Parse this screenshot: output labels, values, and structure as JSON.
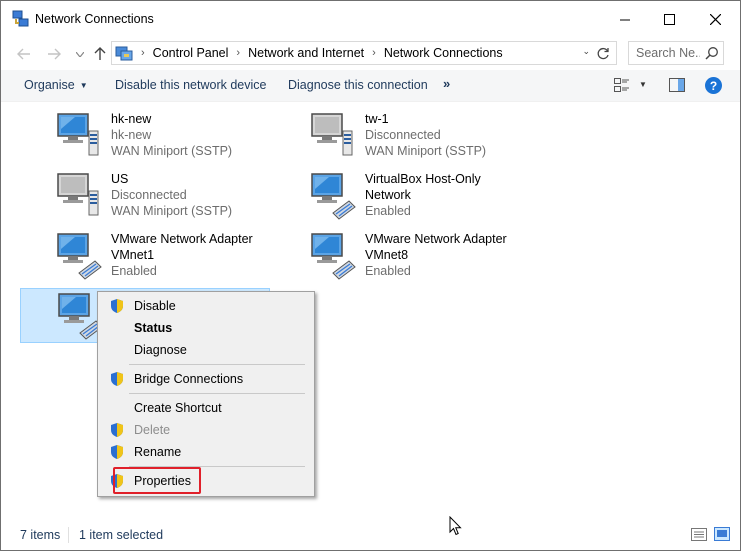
{
  "window": {
    "title": "Network Connections",
    "minimize_glyph": "minimize-icon",
    "maximize_glyph": "maximize-icon",
    "close_glyph": "close-icon"
  },
  "address": {
    "breadcrumbs": [
      "Control Panel",
      "Network and Internet",
      "Network Connections"
    ],
    "search_placeholder": "Search Ne..."
  },
  "toolbar": {
    "organise_label": "Organise",
    "disable_label": "Disable this network device",
    "diagnose_label": "Diagnose this connection",
    "more_label": "»",
    "help_label": "?"
  },
  "connections": [
    {
      "name": "hk-new",
      "status": "hk-new",
      "device": "WAN Miniport (SSTP)",
      "icon": "network-wan-icon"
    },
    {
      "name": "tw-1",
      "status": "Disconnected",
      "device": "WAN Miniport (SSTP)",
      "icon": "network-wan-disconnected-icon"
    },
    {
      "name": "US",
      "status": "Disconnected",
      "device": "WAN Miniport (SSTP)",
      "icon": "network-wan-disconnected-icon"
    },
    {
      "name": "VirtualBox Host-Only",
      "name2": "Network",
      "status": "Enabled",
      "icon": "network-adapter-icon"
    },
    {
      "name": "VMware Network Adapter",
      "name2": "VMnet1",
      "status": "Enabled",
      "icon": "network-adapter-icon"
    },
    {
      "name": "VMware Network Adapter",
      "name2": "VMnet8",
      "status": "Enabled",
      "icon": "network-adapter-icon"
    },
    {
      "name": "",
      "status": "",
      "icon": "network-adapter-icon"
    }
  ],
  "context_menu": {
    "items": [
      {
        "label": "Disable",
        "shield": true
      },
      {
        "label": "Status",
        "bold": true
      },
      {
        "label": "Diagnose"
      },
      {
        "label": "Bridge Connections",
        "shield": true
      },
      {
        "label": "Create Shortcut"
      },
      {
        "label": "Delete",
        "shield": true,
        "disabled": true
      },
      {
        "label": "Rename",
        "shield": true
      },
      {
        "label": "Properties",
        "shield": true,
        "highlighted": true
      }
    ],
    "highlight_color": "#e0202a"
  },
  "status": {
    "item_count": "7 items",
    "selected": "1 item selected"
  },
  "colors": {
    "selection_bg": "#cce8ff",
    "link_text": "#1e395b",
    "secondary_text": "#6d6d6d"
  }
}
